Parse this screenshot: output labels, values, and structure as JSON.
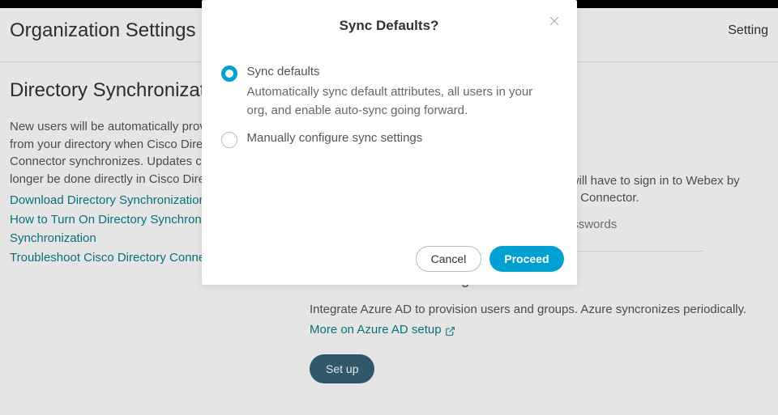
{
  "header": {
    "page_title": "Organization Settings",
    "right_link": "Setting"
  },
  "left": {
    "heading": "Directory Synchronization",
    "body": "New users will be automatically provisioned from your directory when Cisco Directory Connector synchronizes. Updates can no longer be done directly in Cisco Directory.",
    "links": {
      "download": "Download Directory Synchronization client",
      "howto": "How to Turn On Directory Synchronization",
      "sync_label": "Synchronization",
      "troubleshoot": "Troubleshoot Cisco Directory Connector"
    }
  },
  "right": {
    "passwords_p": "swords will have to sign in to Webex by Directory Connector.",
    "hint": "ange passwords",
    "azure_heading": "Microsoft Azure AD integration",
    "azure_body": "Integrate Azure AD to provision users and groups. Azure syncronizes periodically.",
    "azure_link": "More on Azure AD setup",
    "setup_btn": "Set up"
  },
  "modal": {
    "title": "Sync Defaults?",
    "opt1_label": "Sync defaults",
    "opt1_desc": "Automatically sync default attributes, all users in your org, and enable auto-sync going forward.",
    "opt2_label": "Manually configure sync settings",
    "cancel": "Cancel",
    "proceed": "Proceed"
  }
}
